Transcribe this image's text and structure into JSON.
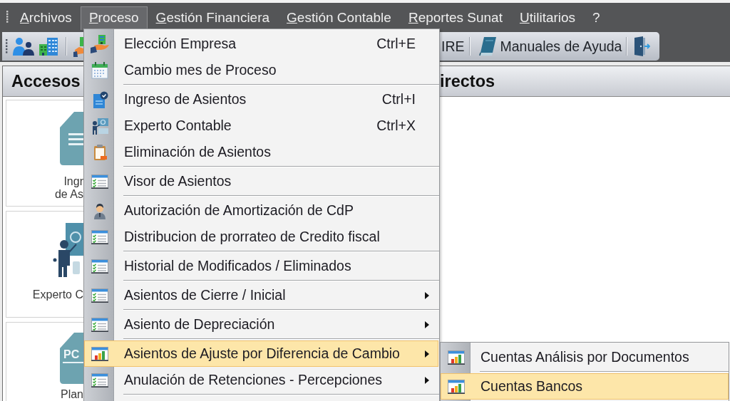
{
  "menu_bar": {
    "items": [
      {
        "label": "Archivos",
        "selected": false,
        "mnemonic": true
      },
      {
        "label": "Proceso",
        "selected": true,
        "mnemonic": true
      },
      {
        "label": "Gestión Financiera",
        "selected": false,
        "mnemonic": true
      },
      {
        "label": "Gestión Contable",
        "selected": false,
        "mnemonic": true
      },
      {
        "label": "Reportes Sunat",
        "selected": false,
        "mnemonic": true
      },
      {
        "label": "Utilitarios",
        "selected": false,
        "mnemonic": true
      },
      {
        "label": "?",
        "selected": false,
        "mnemonic": false
      }
    ]
  },
  "toolbar": {
    "buttons": [
      {
        "label": "IRE"
      },
      {
        "label": "Manuales de Ayuda"
      }
    ]
  },
  "panel": {
    "title_left": "Accesos",
    "title_right": "irectos",
    "tiles": [
      {
        "label": "Ingr\nde As"
      },
      {
        "label": "Experto C"
      },
      {
        "label": "Plan",
        "icon_text": "PC"
      }
    ]
  },
  "dropdown": {
    "items": [
      {
        "kind": "item",
        "label": "Elección Empresa",
        "shortcut": "Ctrl+E",
        "submenu": false,
        "selected": false
      },
      {
        "kind": "item",
        "label": "Cambio mes de Proceso",
        "submenu": false,
        "selected": false
      },
      {
        "kind": "separator"
      },
      {
        "kind": "item",
        "label": "Ingreso de Asientos",
        "shortcut": "Ctrl+I",
        "submenu": false,
        "selected": false
      },
      {
        "kind": "item",
        "label": "Experto Contable",
        "shortcut": "Ctrl+X",
        "submenu": false,
        "selected": false
      },
      {
        "kind": "item",
        "label": "Eliminación de Asientos",
        "submenu": false,
        "selected": false
      },
      {
        "kind": "separator"
      },
      {
        "kind": "item",
        "label": "Visor de Asientos",
        "submenu": false,
        "selected": false
      },
      {
        "kind": "separator"
      },
      {
        "kind": "item",
        "label": "Autorización de Amortización de CdP",
        "submenu": false,
        "selected": false
      },
      {
        "kind": "item",
        "label": "Distribucion de prorrateo de Credito fiscal",
        "submenu": false,
        "selected": false
      },
      {
        "kind": "separator"
      },
      {
        "kind": "item",
        "label": "Historial de Modificados / Eliminados",
        "submenu": false,
        "selected": false
      },
      {
        "kind": "separator"
      },
      {
        "kind": "item",
        "label": "Asientos de Cierre / Inicial",
        "submenu": true,
        "selected": false
      },
      {
        "kind": "separator"
      },
      {
        "kind": "item",
        "label": "Asiento de Depreciación",
        "submenu": true,
        "selected": false
      },
      {
        "kind": "separator"
      },
      {
        "kind": "item",
        "label": "Asientos de Ajuste por Diferencia de Cambio",
        "submenu": true,
        "selected": true
      },
      {
        "kind": "item",
        "label": "Anulación de Retenciones - Percepciones",
        "submenu": true,
        "selected": false
      },
      {
        "kind": "separator"
      }
    ]
  },
  "submenu": {
    "items": [
      {
        "label": "Cuentas Análisis por Documentos",
        "selected": false
      },
      {
        "label": "Cuentas Bancos",
        "selected": true
      }
    ]
  }
}
